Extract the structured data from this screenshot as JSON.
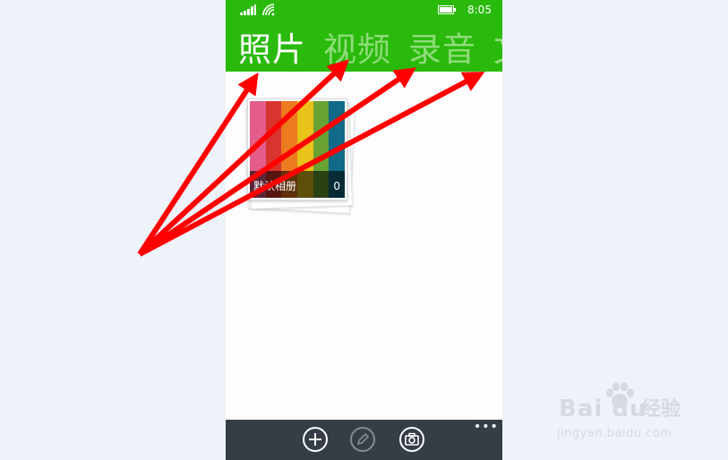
{
  "status_bar": {
    "time": "8:05",
    "icons": [
      "signal-icon",
      "wifi-icon",
      "battery-icon"
    ]
  },
  "pivot": {
    "tabs": [
      {
        "label": "照片",
        "active": true
      },
      {
        "label": "视频",
        "active": false
      },
      {
        "label": "录音",
        "active": false
      },
      {
        "label": "文",
        "active": false
      }
    ]
  },
  "albums": [
    {
      "name": "默认相册",
      "count": "0"
    }
  ],
  "app_bar": {
    "buttons": [
      "add-icon",
      "edit-icon",
      "camera-icon"
    ],
    "more": "•••"
  },
  "watermark": {
    "logo": "Bai du",
    "brand": "经验",
    "url": "jingyan.baidu.com"
  },
  "colors": {
    "header": "#2aba0c",
    "tab_active": "#ffffff",
    "tab_inactive": "#8fdc7a",
    "app_bar": "#353d47",
    "annotation_arrows": "#ff0000",
    "page_background": "#eef2f9"
  },
  "album_cover_stripes": [
    "#e45d8a",
    "#d9352e",
    "#eb7b1e",
    "#e9c21a",
    "#6aa233",
    "#0f6b87"
  ]
}
